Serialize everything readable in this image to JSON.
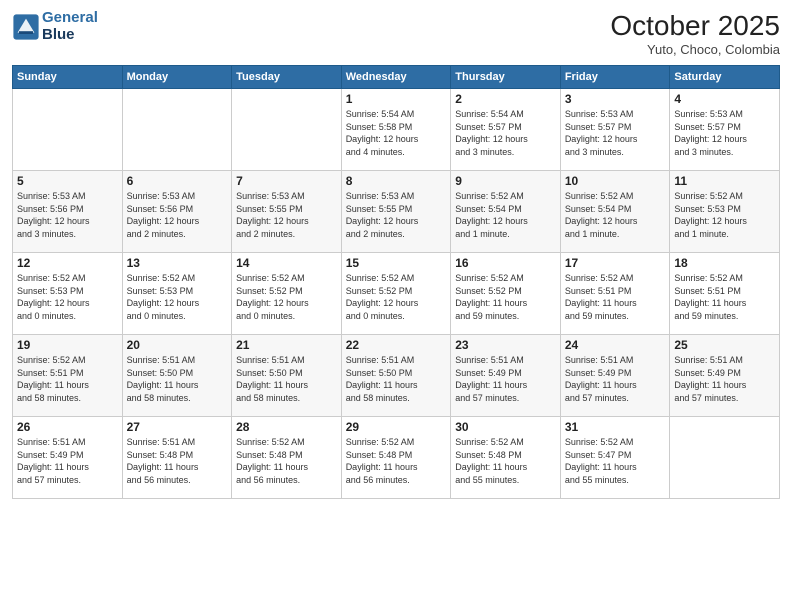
{
  "header": {
    "logo_line1": "General",
    "logo_line2": "Blue",
    "month": "October 2025",
    "location": "Yuto, Choco, Colombia"
  },
  "days_of_week": [
    "Sunday",
    "Monday",
    "Tuesday",
    "Wednesday",
    "Thursday",
    "Friday",
    "Saturday"
  ],
  "weeks": [
    [
      {
        "day": "",
        "info": ""
      },
      {
        "day": "",
        "info": ""
      },
      {
        "day": "",
        "info": ""
      },
      {
        "day": "1",
        "info": "Sunrise: 5:54 AM\nSunset: 5:58 PM\nDaylight: 12 hours\nand 4 minutes."
      },
      {
        "day": "2",
        "info": "Sunrise: 5:54 AM\nSunset: 5:57 PM\nDaylight: 12 hours\nand 3 minutes."
      },
      {
        "day": "3",
        "info": "Sunrise: 5:53 AM\nSunset: 5:57 PM\nDaylight: 12 hours\nand 3 minutes."
      },
      {
        "day": "4",
        "info": "Sunrise: 5:53 AM\nSunset: 5:57 PM\nDaylight: 12 hours\nand 3 minutes."
      }
    ],
    [
      {
        "day": "5",
        "info": "Sunrise: 5:53 AM\nSunset: 5:56 PM\nDaylight: 12 hours\nand 3 minutes."
      },
      {
        "day": "6",
        "info": "Sunrise: 5:53 AM\nSunset: 5:56 PM\nDaylight: 12 hours\nand 2 minutes."
      },
      {
        "day": "7",
        "info": "Sunrise: 5:53 AM\nSunset: 5:55 PM\nDaylight: 12 hours\nand 2 minutes."
      },
      {
        "day": "8",
        "info": "Sunrise: 5:53 AM\nSunset: 5:55 PM\nDaylight: 12 hours\nand 2 minutes."
      },
      {
        "day": "9",
        "info": "Sunrise: 5:52 AM\nSunset: 5:54 PM\nDaylight: 12 hours\nand 1 minute."
      },
      {
        "day": "10",
        "info": "Sunrise: 5:52 AM\nSunset: 5:54 PM\nDaylight: 12 hours\nand 1 minute."
      },
      {
        "day": "11",
        "info": "Sunrise: 5:52 AM\nSunset: 5:53 PM\nDaylight: 12 hours\nand 1 minute."
      }
    ],
    [
      {
        "day": "12",
        "info": "Sunrise: 5:52 AM\nSunset: 5:53 PM\nDaylight: 12 hours\nand 0 minutes."
      },
      {
        "day": "13",
        "info": "Sunrise: 5:52 AM\nSunset: 5:53 PM\nDaylight: 12 hours\nand 0 minutes."
      },
      {
        "day": "14",
        "info": "Sunrise: 5:52 AM\nSunset: 5:52 PM\nDaylight: 12 hours\nand 0 minutes."
      },
      {
        "day": "15",
        "info": "Sunrise: 5:52 AM\nSunset: 5:52 PM\nDaylight: 12 hours\nand 0 minutes."
      },
      {
        "day": "16",
        "info": "Sunrise: 5:52 AM\nSunset: 5:52 PM\nDaylight: 11 hours\nand 59 minutes."
      },
      {
        "day": "17",
        "info": "Sunrise: 5:52 AM\nSunset: 5:51 PM\nDaylight: 11 hours\nand 59 minutes."
      },
      {
        "day": "18",
        "info": "Sunrise: 5:52 AM\nSunset: 5:51 PM\nDaylight: 11 hours\nand 59 minutes."
      }
    ],
    [
      {
        "day": "19",
        "info": "Sunrise: 5:52 AM\nSunset: 5:51 PM\nDaylight: 11 hours\nand 58 minutes."
      },
      {
        "day": "20",
        "info": "Sunrise: 5:51 AM\nSunset: 5:50 PM\nDaylight: 11 hours\nand 58 minutes."
      },
      {
        "day": "21",
        "info": "Sunrise: 5:51 AM\nSunset: 5:50 PM\nDaylight: 11 hours\nand 58 minutes."
      },
      {
        "day": "22",
        "info": "Sunrise: 5:51 AM\nSunset: 5:50 PM\nDaylight: 11 hours\nand 58 minutes."
      },
      {
        "day": "23",
        "info": "Sunrise: 5:51 AM\nSunset: 5:49 PM\nDaylight: 11 hours\nand 57 minutes."
      },
      {
        "day": "24",
        "info": "Sunrise: 5:51 AM\nSunset: 5:49 PM\nDaylight: 11 hours\nand 57 minutes."
      },
      {
        "day": "25",
        "info": "Sunrise: 5:51 AM\nSunset: 5:49 PM\nDaylight: 11 hours\nand 57 minutes."
      }
    ],
    [
      {
        "day": "26",
        "info": "Sunrise: 5:51 AM\nSunset: 5:49 PM\nDaylight: 11 hours\nand 57 minutes."
      },
      {
        "day": "27",
        "info": "Sunrise: 5:51 AM\nSunset: 5:48 PM\nDaylight: 11 hours\nand 56 minutes."
      },
      {
        "day": "28",
        "info": "Sunrise: 5:52 AM\nSunset: 5:48 PM\nDaylight: 11 hours\nand 56 minutes."
      },
      {
        "day": "29",
        "info": "Sunrise: 5:52 AM\nSunset: 5:48 PM\nDaylight: 11 hours\nand 56 minutes."
      },
      {
        "day": "30",
        "info": "Sunrise: 5:52 AM\nSunset: 5:48 PM\nDaylight: 11 hours\nand 55 minutes."
      },
      {
        "day": "31",
        "info": "Sunrise: 5:52 AM\nSunset: 5:47 PM\nDaylight: 11 hours\nand 55 minutes."
      },
      {
        "day": "",
        "info": ""
      }
    ]
  ]
}
